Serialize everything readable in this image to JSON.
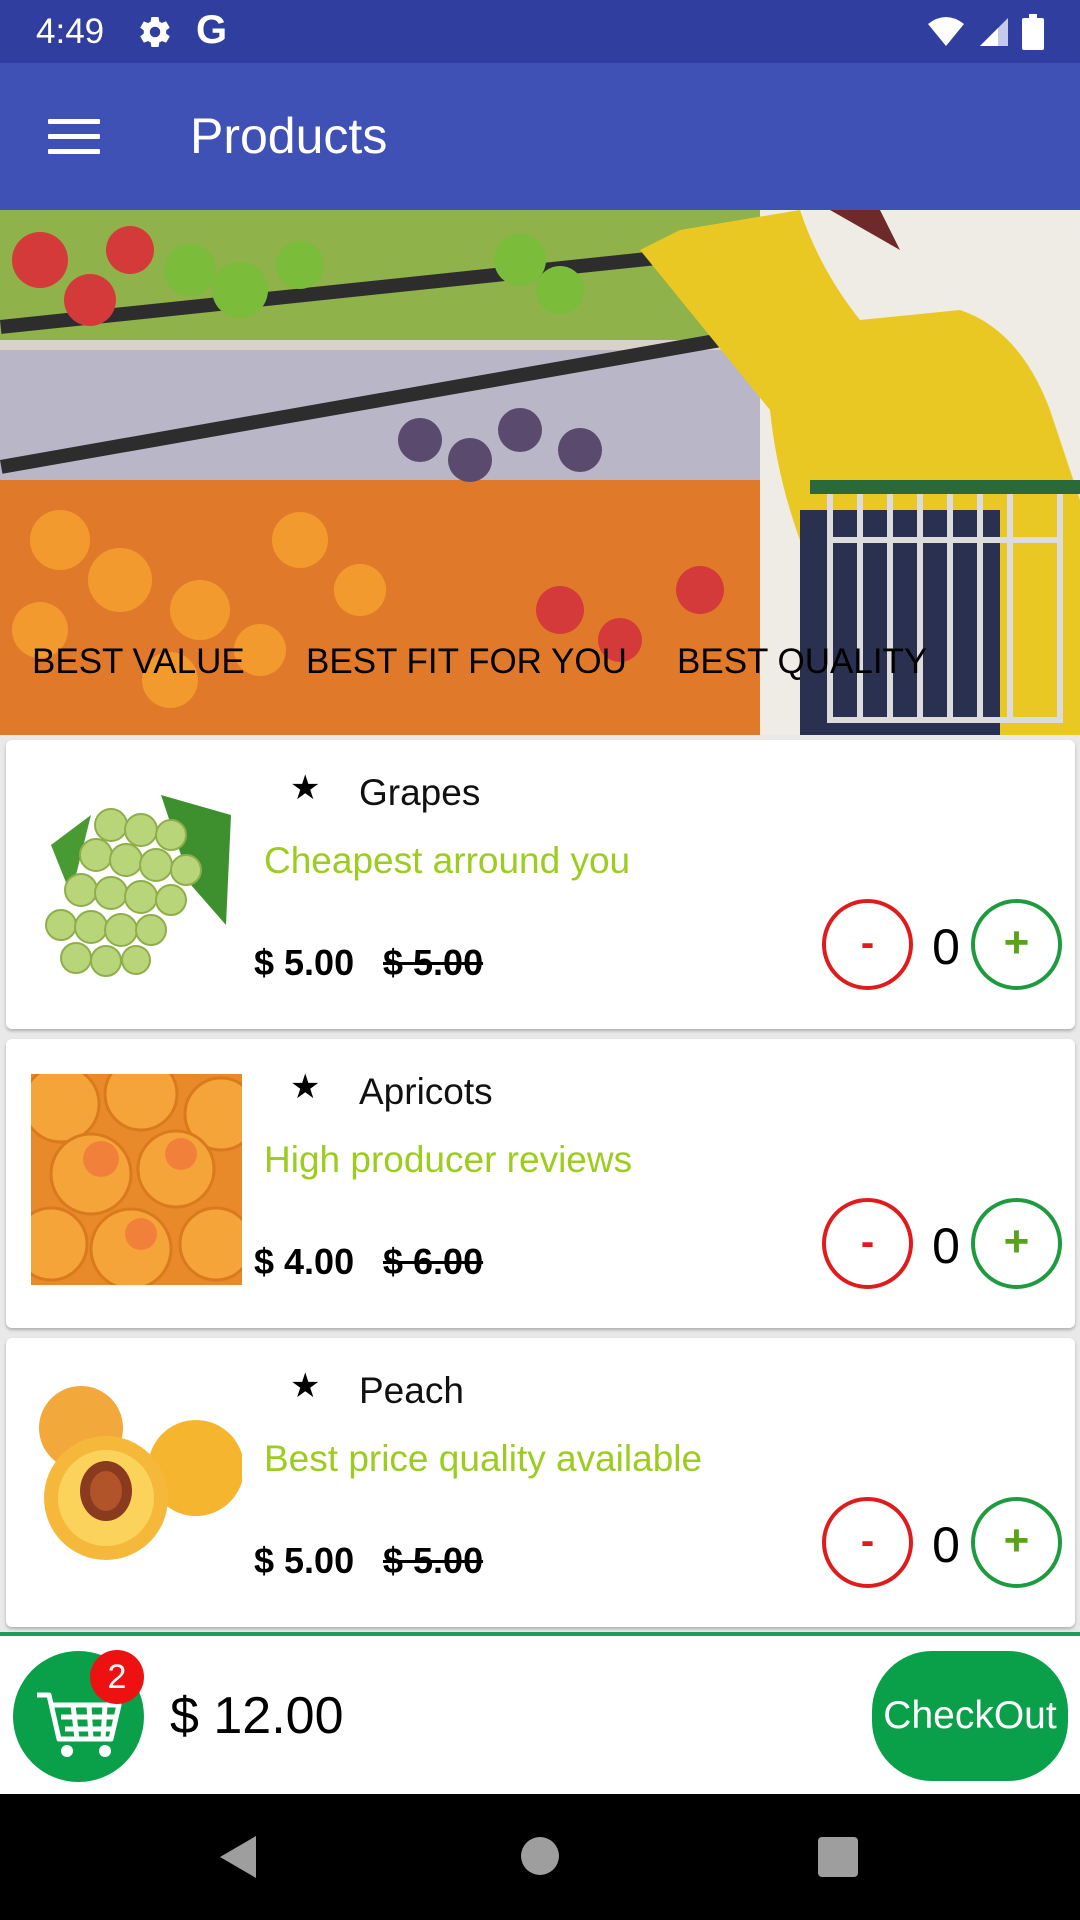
{
  "status_bar": {
    "time": "4:49",
    "g_label": "G"
  },
  "app_bar": {
    "title": "Products",
    "menu_icon": "menu-icon"
  },
  "hero": {
    "tabs": [
      "BEST VALUE",
      "BEST FIT FOR YOU",
      "BEST QUALITY"
    ]
  },
  "products": [
    {
      "name": "Grapes",
      "tagline": "Cheapest arround you",
      "price": "$ 5.00",
      "old_price": "$ 5.00",
      "quantity": "0",
      "minus_label": "-",
      "plus_label": "+"
    },
    {
      "name": "Apricots",
      "tagline": "High producer reviews",
      "price": "$ 4.00",
      "old_price": "$ 6.00",
      "quantity": "0",
      "minus_label": "-",
      "plus_label": "+"
    },
    {
      "name": "Peach",
      "tagline": "Best price quality available",
      "price": "$ 5.00",
      "old_price": "$ 5.00",
      "quantity": "0",
      "minus_label": "-",
      "plus_label": "+"
    }
  ],
  "footer": {
    "cart_badge": "2",
    "total": "$ 12.00",
    "checkout_label": "CheckOut"
  },
  "colors": {
    "primary_dark": "#303f9f",
    "primary": "#3f51b5",
    "accent_green": "#0aa04a",
    "tagline_green": "#9ccd1e",
    "minus_red": "#e01b1b"
  }
}
